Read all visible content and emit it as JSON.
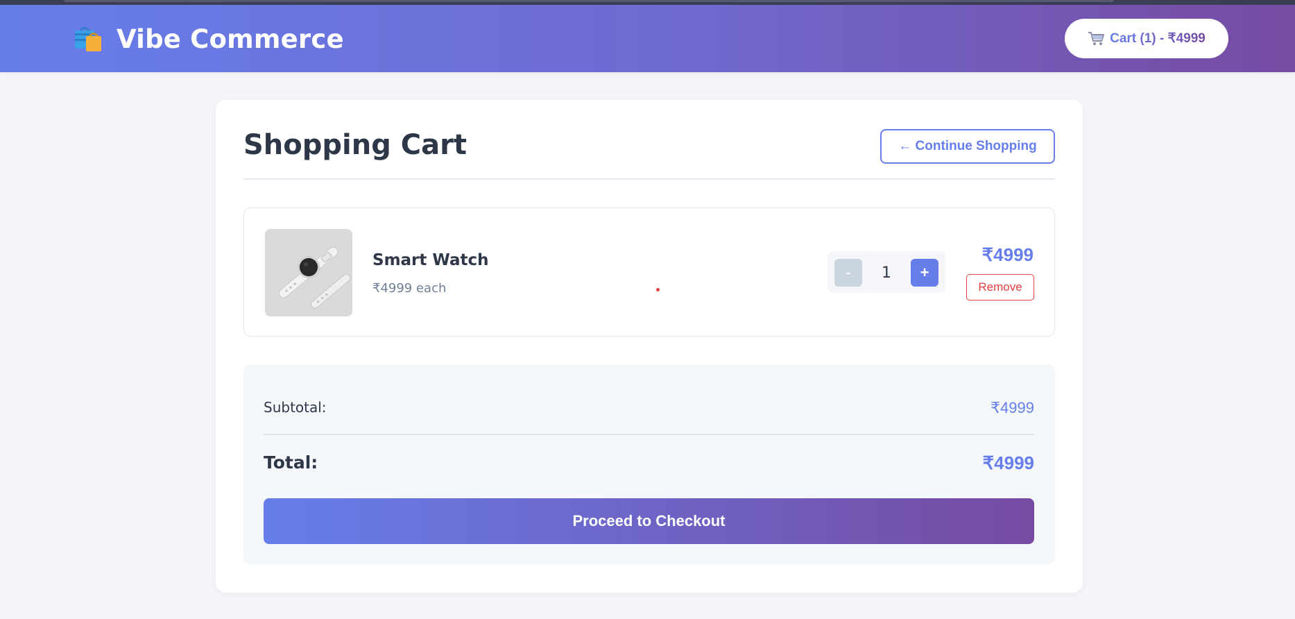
{
  "header": {
    "brand": "Vibe Commerce",
    "logo_icon": "shopping-bags-icon",
    "cart_icon": "shopping-cart-icon",
    "cart_label": "Cart (1) - ₹4999"
  },
  "cart": {
    "title": "Shopping Cart",
    "continue_label": "← Continue Shopping",
    "items": [
      {
        "name": "Smart Watch",
        "unit_price": "₹4999 each",
        "quantity": "1",
        "decrement_label": "-",
        "increment_label": "+",
        "line_total": "₹4999",
        "remove_label": "Remove",
        "image_icon": "smart-watch-image"
      }
    ]
  },
  "summary": {
    "subtotal_label": "Subtotal:",
    "subtotal_value": "₹4999",
    "total_label": "Total:",
    "total_value": "₹4999",
    "checkout_label": "Proceed to Checkout"
  },
  "colors": {
    "accent": "#667eea",
    "accent_end": "#764ba2",
    "danger": "#e53e3e"
  }
}
